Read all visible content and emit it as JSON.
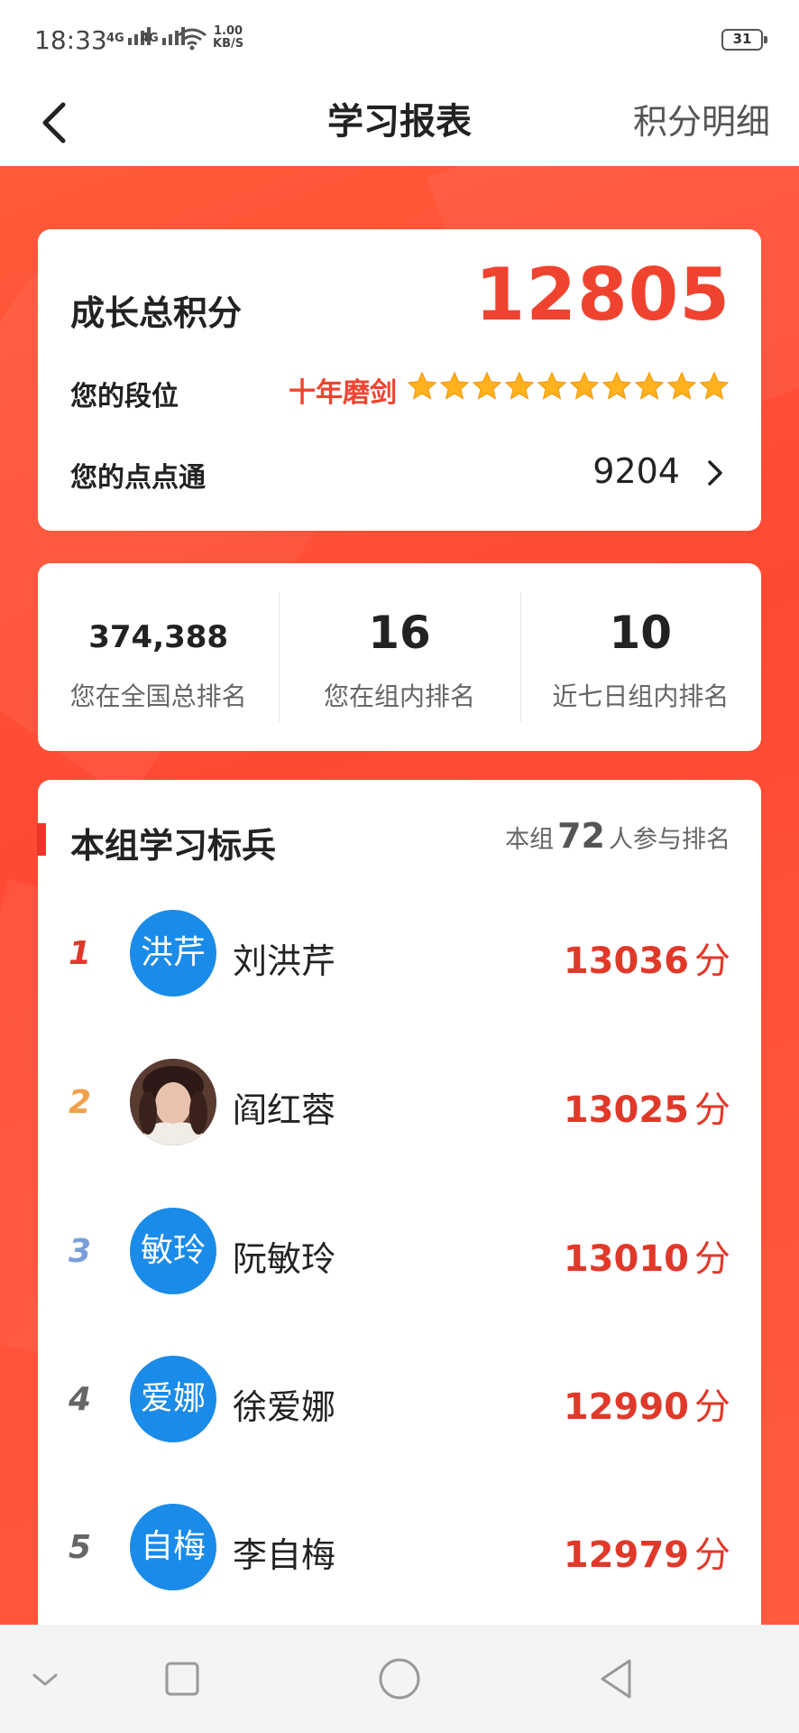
{
  "status": {
    "time": "18:33",
    "signal1": "4G",
    "signal2": "4G",
    "speed_top": "1.00",
    "speed_bottom": "KB/S",
    "battery": "31"
  },
  "header": {
    "back_icon": "chevron-left-icon",
    "title": "学习报表",
    "right_link": "积分明细"
  },
  "summary": {
    "total_label": "成长总积分",
    "total_value": "12805",
    "rank_label": "您的段位",
    "rank_title": "十年磨剑",
    "rank_stars": 10,
    "diandiantong_label": "您的点点通",
    "diandiantong_value": "9204"
  },
  "stats": [
    {
      "value": "374,388",
      "label": "您在全国总排名"
    },
    {
      "value": "16",
      "label": "您在组内排名"
    },
    {
      "value": "10",
      "label": "近七日组内排名"
    }
  ],
  "leaderboard": {
    "title": "本组学习标兵",
    "participants_prefix": "本组",
    "participants_count": "72",
    "participants_suffix": "人参与排名",
    "rows": [
      {
        "rank": "1",
        "avatar_text": "洪芹",
        "name": "刘洪芹",
        "score": "13036",
        "unit": "分",
        "rank_color": "#e0392a"
      },
      {
        "rank": "2",
        "avatar_text": "",
        "name": "阎红蓉",
        "score": "13025",
        "unit": "分",
        "rank_color": "#f0a04a"
      },
      {
        "rank": "3",
        "avatar_text": "敏玲",
        "name": "阮敏玲",
        "score": "13010",
        "unit": "分",
        "rank_color": "#7a9fd8"
      },
      {
        "rank": "4",
        "avatar_text": "爱娜",
        "name": "徐爱娜",
        "score": "12990",
        "unit": "分",
        "rank_color": "#666666"
      },
      {
        "rank": "5",
        "avatar_text": "自梅",
        "name": "李自梅",
        "score": "12979",
        "unit": "分",
        "rank_color": "#666666"
      }
    ]
  },
  "colors": {
    "accent": "#f0432f",
    "avatar_blue": "#1a8be8"
  }
}
